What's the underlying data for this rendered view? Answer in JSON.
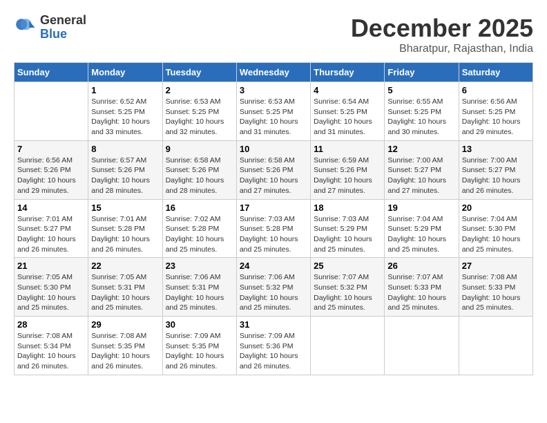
{
  "header": {
    "logo_general": "General",
    "logo_blue": "Blue",
    "month": "December 2025",
    "location": "Bharatpur, Rajasthan, India"
  },
  "weekdays": [
    "Sunday",
    "Monday",
    "Tuesday",
    "Wednesday",
    "Thursday",
    "Friday",
    "Saturday"
  ],
  "weeks": [
    [
      {
        "day": "",
        "info": ""
      },
      {
        "day": "1",
        "info": "Sunrise: 6:52 AM\nSunset: 5:25 PM\nDaylight: 10 hours\nand 33 minutes."
      },
      {
        "day": "2",
        "info": "Sunrise: 6:53 AM\nSunset: 5:25 PM\nDaylight: 10 hours\nand 32 minutes."
      },
      {
        "day": "3",
        "info": "Sunrise: 6:53 AM\nSunset: 5:25 PM\nDaylight: 10 hours\nand 31 minutes."
      },
      {
        "day": "4",
        "info": "Sunrise: 6:54 AM\nSunset: 5:25 PM\nDaylight: 10 hours\nand 31 minutes."
      },
      {
        "day": "5",
        "info": "Sunrise: 6:55 AM\nSunset: 5:25 PM\nDaylight: 10 hours\nand 30 minutes."
      },
      {
        "day": "6",
        "info": "Sunrise: 6:56 AM\nSunset: 5:25 PM\nDaylight: 10 hours\nand 29 minutes."
      }
    ],
    [
      {
        "day": "7",
        "info": "Sunrise: 6:56 AM\nSunset: 5:26 PM\nDaylight: 10 hours\nand 29 minutes."
      },
      {
        "day": "8",
        "info": "Sunrise: 6:57 AM\nSunset: 5:26 PM\nDaylight: 10 hours\nand 28 minutes."
      },
      {
        "day": "9",
        "info": "Sunrise: 6:58 AM\nSunset: 5:26 PM\nDaylight: 10 hours\nand 28 minutes."
      },
      {
        "day": "10",
        "info": "Sunrise: 6:58 AM\nSunset: 5:26 PM\nDaylight: 10 hours\nand 27 minutes."
      },
      {
        "day": "11",
        "info": "Sunrise: 6:59 AM\nSunset: 5:26 PM\nDaylight: 10 hours\nand 27 minutes."
      },
      {
        "day": "12",
        "info": "Sunrise: 7:00 AM\nSunset: 5:27 PM\nDaylight: 10 hours\nand 27 minutes."
      },
      {
        "day": "13",
        "info": "Sunrise: 7:00 AM\nSunset: 5:27 PM\nDaylight: 10 hours\nand 26 minutes."
      }
    ],
    [
      {
        "day": "14",
        "info": "Sunrise: 7:01 AM\nSunset: 5:27 PM\nDaylight: 10 hours\nand 26 minutes."
      },
      {
        "day": "15",
        "info": "Sunrise: 7:01 AM\nSunset: 5:28 PM\nDaylight: 10 hours\nand 26 minutes."
      },
      {
        "day": "16",
        "info": "Sunrise: 7:02 AM\nSunset: 5:28 PM\nDaylight: 10 hours\nand 25 minutes."
      },
      {
        "day": "17",
        "info": "Sunrise: 7:03 AM\nSunset: 5:28 PM\nDaylight: 10 hours\nand 25 minutes."
      },
      {
        "day": "18",
        "info": "Sunrise: 7:03 AM\nSunset: 5:29 PM\nDaylight: 10 hours\nand 25 minutes."
      },
      {
        "day": "19",
        "info": "Sunrise: 7:04 AM\nSunset: 5:29 PM\nDaylight: 10 hours\nand 25 minutes."
      },
      {
        "day": "20",
        "info": "Sunrise: 7:04 AM\nSunset: 5:30 PM\nDaylight: 10 hours\nand 25 minutes."
      }
    ],
    [
      {
        "day": "21",
        "info": "Sunrise: 7:05 AM\nSunset: 5:30 PM\nDaylight: 10 hours\nand 25 minutes."
      },
      {
        "day": "22",
        "info": "Sunrise: 7:05 AM\nSunset: 5:31 PM\nDaylight: 10 hours\nand 25 minutes."
      },
      {
        "day": "23",
        "info": "Sunrise: 7:06 AM\nSunset: 5:31 PM\nDaylight: 10 hours\nand 25 minutes."
      },
      {
        "day": "24",
        "info": "Sunrise: 7:06 AM\nSunset: 5:32 PM\nDaylight: 10 hours\nand 25 minutes."
      },
      {
        "day": "25",
        "info": "Sunrise: 7:07 AM\nSunset: 5:32 PM\nDaylight: 10 hours\nand 25 minutes."
      },
      {
        "day": "26",
        "info": "Sunrise: 7:07 AM\nSunset: 5:33 PM\nDaylight: 10 hours\nand 25 minutes."
      },
      {
        "day": "27",
        "info": "Sunrise: 7:08 AM\nSunset: 5:33 PM\nDaylight: 10 hours\nand 25 minutes."
      }
    ],
    [
      {
        "day": "28",
        "info": "Sunrise: 7:08 AM\nSunset: 5:34 PM\nDaylight: 10 hours\nand 26 minutes."
      },
      {
        "day": "29",
        "info": "Sunrise: 7:08 AM\nSunset: 5:35 PM\nDaylight: 10 hours\nand 26 minutes."
      },
      {
        "day": "30",
        "info": "Sunrise: 7:09 AM\nSunset: 5:35 PM\nDaylight: 10 hours\nand 26 minutes."
      },
      {
        "day": "31",
        "info": "Sunrise: 7:09 AM\nSunset: 5:36 PM\nDaylight: 10 hours\nand 26 minutes."
      },
      {
        "day": "",
        "info": ""
      },
      {
        "day": "",
        "info": ""
      },
      {
        "day": "",
        "info": ""
      }
    ]
  ]
}
